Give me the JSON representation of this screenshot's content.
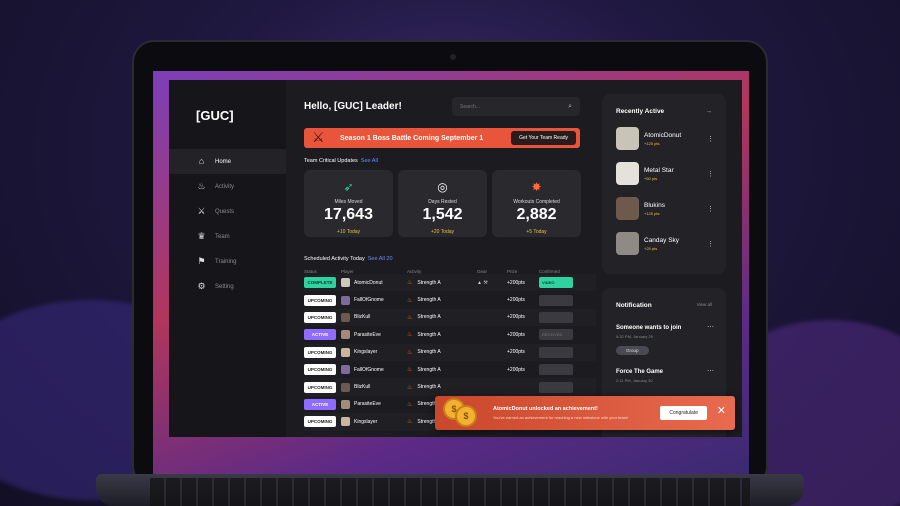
{
  "sidebar": {
    "brand": "[GUC]",
    "items": [
      {
        "label": "Home",
        "icon": "home-icon",
        "glyph": "⌂",
        "active": true
      },
      {
        "label": "Activity",
        "icon": "flame-icon",
        "glyph": "♨",
        "active": false
      },
      {
        "label": "Quests",
        "icon": "swords-icon",
        "glyph": "⚔",
        "active": false
      },
      {
        "label": "Team",
        "icon": "crown-icon",
        "glyph": "♛",
        "active": false
      },
      {
        "label": "Training",
        "icon": "training-icon",
        "glyph": "⚑",
        "active": false
      },
      {
        "label": "Setting",
        "icon": "gear-icon",
        "glyph": "⚙",
        "active": false
      }
    ]
  },
  "header": {
    "greeting": "Hello, [GUC] Leader!",
    "search_placeholder": "Search..."
  },
  "banner": {
    "text": "Season 1 Boss Battle Coming September 1",
    "button": "Get Your Team Ready"
  },
  "updates": {
    "title": "Team Critical Updates",
    "see": "See All",
    "stats": [
      {
        "label": "Miles Moved",
        "value": "17,643",
        "delta": "+10 Today",
        "icon": "running-icon"
      },
      {
        "label": "Days Rested",
        "value": "1,542",
        "delta": "+20 Today",
        "icon": "halo-icon"
      },
      {
        "label": "Workouts Completed",
        "value": "2,882",
        "delta": "+5 Today",
        "icon": "explosion-icon"
      }
    ]
  },
  "schedule": {
    "title": "Scheduled Activity Today",
    "see": "See All 20",
    "columns": [
      "Status",
      "Player",
      "Activity",
      "Gear",
      "Prize",
      "Confirmed"
    ],
    "rows": [
      {
        "status": "COMPLETE",
        "player": "AtomicDonut",
        "activity": "Strength A",
        "gear": "▲ ⚒",
        "prize": "+200pts",
        "confirmed": "VIDEO"
      },
      {
        "status": "UPCOMING",
        "player": "FallOfGnome",
        "activity": "Strength A",
        "gear": "",
        "prize": "+200pts",
        "confirmed": ""
      },
      {
        "status": "UPCOMING",
        "player": "BlizKull",
        "activity": "Strength A",
        "gear": "",
        "prize": "+200pts",
        "confirmed": ""
      },
      {
        "status": "ACTIVE",
        "player": "ParasiteEve",
        "activity": "Strength A",
        "gear": "",
        "prize": "+200pts",
        "confirmed": "RECEIVED"
      },
      {
        "status": "UPCOMING",
        "player": "Kingslayer",
        "activity": "Strength A",
        "gear": "",
        "prize": "+200pts",
        "confirmed": ""
      },
      {
        "status": "UPCOMING",
        "player": "FallOfGnome",
        "activity": "Strength A",
        "gear": "",
        "prize": "+200pts",
        "confirmed": ""
      },
      {
        "status": "UPCOMING",
        "player": "BlizKull",
        "activity": "Strength A",
        "gear": "",
        "prize": "",
        "confirmed": ""
      },
      {
        "status": "ACTIVE",
        "player": "ParasiteEve",
        "activity": "Strength A",
        "gear": "",
        "prize": "",
        "confirmed": ""
      },
      {
        "status": "UPCOMING",
        "player": "Kingslayer",
        "activity": "Strength A",
        "gear": "",
        "prize": "",
        "confirmed": ""
      }
    ]
  },
  "recent": {
    "title": "Recently Active",
    "people": [
      {
        "name": "AtomicDonut",
        "pts": "+125 pts",
        "color": "#c9c4b8"
      },
      {
        "name": "Metal Star",
        "pts": "+50 pts",
        "color": "#e5e2d9"
      },
      {
        "name": "Blukins",
        "pts": "+125 pts",
        "color": "#6d5a4c"
      },
      {
        "name": "Canday Sky",
        "pts": "+25 pts",
        "color": "#8f8a84"
      }
    ]
  },
  "notifications": {
    "title": "Notification",
    "view": "View all",
    "items": [
      {
        "title": "Someone wants to join",
        "time": "5:32 PM, January 29",
        "chip": "Group"
      },
      {
        "title": "Force The  Game",
        "time": "2:11 PM, January 30",
        "chip": ""
      }
    ]
  },
  "toast": {
    "title": "AtomicDonut unlocked an achievement!",
    "sub": "You've earned an achievement for reaching a new milestone with your team!",
    "button": "Congratulate",
    "coin_glyph": "$"
  },
  "colors": {
    "accent": "#e8553a",
    "complete": "#2fd3a0",
    "active": "#8f6bff",
    "points": "#e6c14a"
  }
}
